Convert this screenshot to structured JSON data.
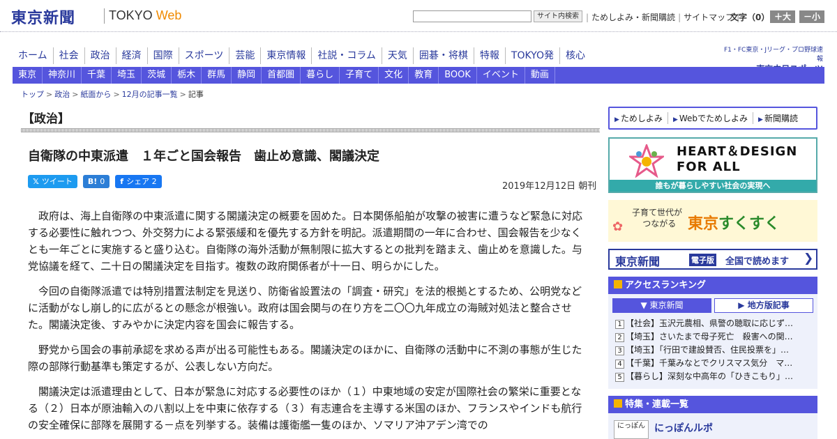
{
  "header": {
    "logo": "東京新聞",
    "logo_en_prefix": "TOKYO",
    "logo_en_suffix": "Web",
    "search_button": "サイト内検索",
    "links": [
      "ためしよみ・新聞購読",
      "サイトマップ"
    ],
    "font_size_label": "文字（0）",
    "font_larger": "＋大",
    "font_smaller": "－小"
  },
  "main_nav": [
    "ホーム",
    "社会",
    "政治",
    "経済",
    "国際",
    "スポーツ",
    "芸能",
    "東京情報",
    "社説・コラム",
    "天気",
    "囲碁・将棋",
    "特報",
    "TOKYO発",
    "核心"
  ],
  "chunichi": {
    "sub": "F1・FC東京・Jリーグ・プロ野球速報",
    "main": "東京中日スポーツ"
  },
  "sub_nav": [
    "東京",
    "神奈川",
    "千葉",
    "埼玉",
    "茨城",
    "栃木",
    "群馬",
    "静岡",
    "首都圏",
    "暮らし",
    "子育て",
    "文化",
    "教育",
    "BOOK",
    "イベント",
    "動画"
  ],
  "breadcrumb": [
    "トップ",
    "政治",
    "紙面から",
    "12月の記事一覧",
    "記事"
  ],
  "article": {
    "section": "【政治】",
    "headline": "自衛隊の中東派遣　１年ごと国会報告　歯止め意識、閣議決定",
    "share": {
      "tweet": "ツイート",
      "hatena_icon": "B!",
      "hatena_count": "0",
      "fb": "シェア",
      "fb_count": "2"
    },
    "date": "2019年12月12日 朝刊",
    "paragraphs": [
      "政府は、海上自衛隊の中東派遣に関する閣議決定の概要を固めた。日本関係船舶が攻撃の被害に遭うなど緊急に対応する必要性に触れつつ、外交努力による緊張緩和を優先する方針を明記。派遣期間の一年に合わせ、国会報告を少なくとも一年ごとに実施すると盛り込む。自衛隊の海外活動が無制限に拡大するとの批判を踏まえ、歯止めを意識した。与党協議を経て、二十日の閣議決定を目指す。複数の政府関係者が十一日、明らかにした。",
      "今回の自衛隊派遣では特別措置法制定を見送り、防衛省設置法の「調査・研究」を法的根拠とするため、公明党などに活動がなし崩し的に広がるとの懸念が根強い。政府は国会関与の在り方を二〇〇九年成立の海賊対処法と整合させた。閣議決定後、すみやかに決定内容を国会に報告する。",
      "野党から国会の事前承認を求める声が出る可能性もある。閣議決定のほかに、自衛隊の活動中に不測の事態が生じた際の部隊行動基準も策定するが、公表しない方向だ。",
      "閣議決定は派遣理由として、日本が緊急に対応する必要性のほか（１）中東地域の安定が国際社会の繁栄に重要となる（２）日本が原油輸入の八割以上を中東に依存する（３）有志連合を主導する米国のほか、フランスやインドも航行の安全確保に部隊を展開する－点を列挙する。装備は護衛艦一隻のほか、ソマリア沖アデン湾での"
    ]
  },
  "sidebar": {
    "buttons": [
      "ためしよみ",
      "Webでためしよみ",
      "新聞購読"
    ],
    "heart": {
      "title_line1": "HEART＆DESIGN",
      "title_line2": "FOR ALL",
      "sub": "誰もが暮らしやすい社会の実現へ"
    },
    "sukusuku": {
      "line1": "子育て世代が",
      "line2": "つながる",
      "main_a": "東京",
      "main_b": "すくすく"
    },
    "denshi": {
      "logo": "東京新聞",
      "badge": "電子版",
      "text": "全国で読めます"
    },
    "ranking": {
      "title": "アクセスランキング",
      "tab_tokyo": "東京新聞",
      "tab_local": "地方版記事",
      "items": [
        {
          "num": "1",
          "text": "【社会】玉沢元農相、県警の聴取に応じず…"
        },
        {
          "num": "2",
          "text": "【埼玉】さいたまで母子死亡　殺害への関…"
        },
        {
          "num": "3",
          "text": "【埼玉】「行田で建設賛否、住民投票を」…"
        },
        {
          "num": "4",
          "text": "【千葉】千葉みなとでクリスマス気分　マ…"
        },
        {
          "num": "5",
          "text": "【暮らし】深刻な中高年の「ひきこもり」…"
        }
      ]
    },
    "features": {
      "title": "特集・連載一覧",
      "thumb": "にっぽん",
      "item": "にっぽんルポ"
    }
  },
  "colors": {
    "brand_blue": "#2a3a9c",
    "nav_purple": "#5555dd",
    "web_orange": "#f08a00"
  }
}
